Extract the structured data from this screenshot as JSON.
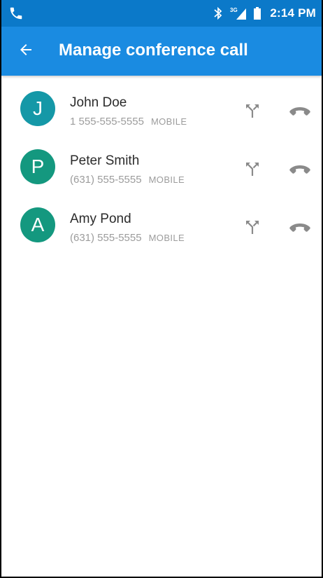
{
  "status_bar": {
    "time": "2:14 PM",
    "network": "3G",
    "icons": [
      "phone-call-icon",
      "bluetooth-icon",
      "signal-3g-icon",
      "battery-icon"
    ]
  },
  "app_bar": {
    "title": "Manage conference call",
    "back_icon": "arrow-back-icon"
  },
  "participants": [
    {
      "initial": "J",
      "name": "John Doe",
      "number": "1 555-555-5555",
      "type": "MOBILE"
    },
    {
      "initial": "P",
      "name": "Peter Smith",
      "number": "(631) 555-5555",
      "type": "MOBILE"
    },
    {
      "initial": "A",
      "name": "Amy Pond",
      "number": "(631) 555-5555",
      "type": "MOBILE"
    }
  ],
  "actions": {
    "split_icon": "call-split-icon",
    "hangup_icon": "call-end-icon"
  },
  "colors": {
    "status_bar": "#0b79c9",
    "app_bar": "#1a8be1",
    "avatar_1": "#1598a7",
    "avatar_2": "#14987f",
    "avatar_3": "#14987f",
    "secondary_text": "#9c9c9c",
    "icon_gray": "#8a8a8a"
  }
}
